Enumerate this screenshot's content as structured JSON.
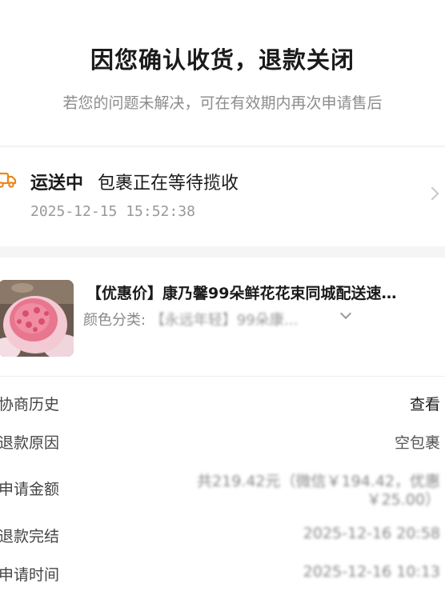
{
  "header": {
    "title": "因您确认收货，退款关闭",
    "subtitle": "若您的问题未解决，可在有效期内再次申请售后"
  },
  "shipping": {
    "icon": "truck-icon",
    "status": "运送中",
    "description": "包裹正在等待揽收",
    "time": "2025-12-15 15:52:38"
  },
  "product": {
    "title": "【优惠价】康乃馨99朵鲜花花束同城配送速…",
    "sku_label": "颜色分类:",
    "sku_value": "【永远年轻】99朵康…"
  },
  "details": {
    "history_label": "协商历史",
    "history_value": "查看",
    "reason_label": "退款原因",
    "reason_value": "空包裹",
    "amount_label": "申请金额",
    "amount_value_line1": "共219.42元（微信￥194.42，优惠",
    "amount_value_line2": "￥25.00）",
    "completed_label": "退款完结",
    "completed_value": "2025-12-16 20:58",
    "applied_label": "申请时间",
    "applied_value": "2025-12-16 10:13"
  },
  "colors": {
    "accent_icon": "#e8891c",
    "title": "#1a1a1a",
    "muted": "#8c8c8c"
  }
}
